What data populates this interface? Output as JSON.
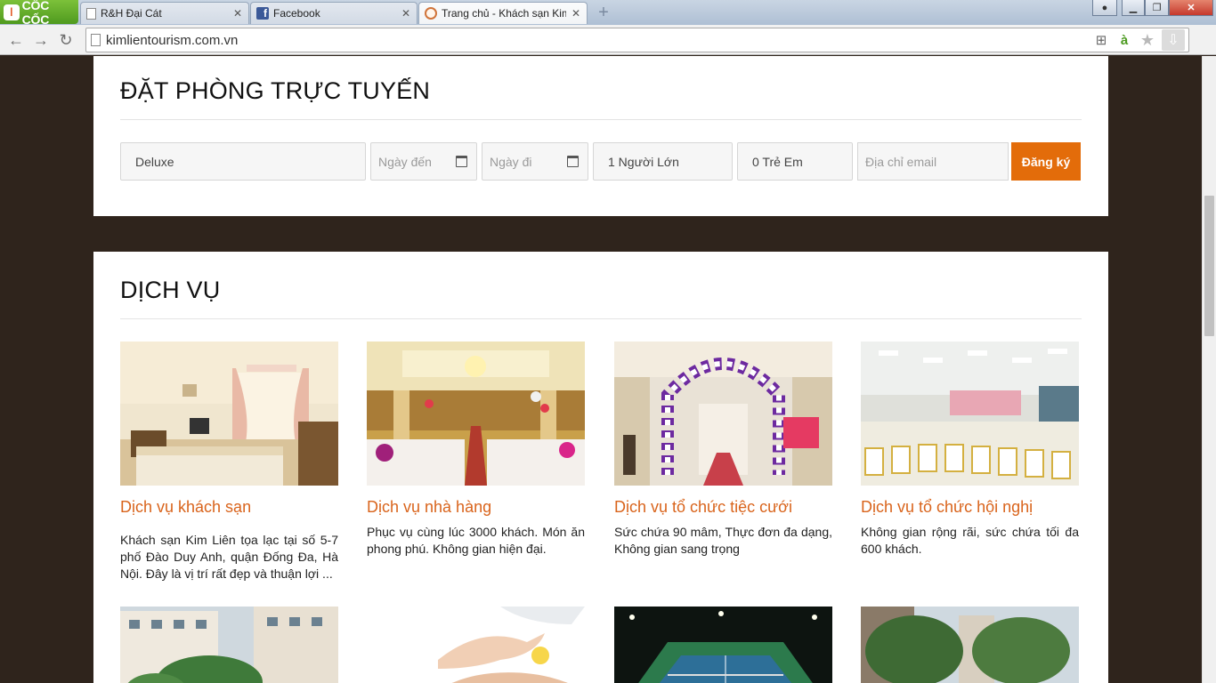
{
  "browser": {
    "brand": "CỐC CỐC",
    "tabs": [
      {
        "title": "R&H Đại Cát",
        "icon": "page-icon"
      },
      {
        "title": "Facebook",
        "icon": "facebook-icon"
      },
      {
        "title": "Trang chủ - Khách sạn Kim Liên",
        "icon": "hotel-icon",
        "active": true
      }
    ],
    "url": "kimlientourism.com.vn"
  },
  "booking": {
    "title": "ĐẶT PHÒNG TRỰC TUYẾN",
    "room_type": "Deluxe",
    "arrival_placeholder": "Ngày đến",
    "departure_placeholder": "Ngày đi",
    "adults": "1 Người Lớn",
    "children": "0 Trẻ Em",
    "email_placeholder": "Địa chỉ email",
    "submit_label": "Đăng ký"
  },
  "services": {
    "title": "DỊCH VỤ",
    "items": [
      {
        "title": "Dịch vụ khách sạn",
        "desc": "Khách sạn Kim Liên tọa lạc tại số 5-7 phố Đào Duy Anh, quận Đống Đa, Hà Nội. Đây là vị trí rất đẹp và thuận lợi ..."
      },
      {
        "title": "Dịch vụ nhà hàng",
        "desc": "Phục vụ cùng lúc 3000 khách. Món ăn phong phú. Không gian hiện đại."
      },
      {
        "title": "Dịch vụ tổ chức tiệc cưới",
        "desc": "Sức chứa 90 mâm, Thực đơn đa dạng, Không gian sang trọng"
      },
      {
        "title": "Dịch vụ tổ chức hội nghị",
        "desc": "Không gian rộng rãi, sức chứa tối đa 600 khách."
      }
    ]
  },
  "colors": {
    "accent": "#e36c0a",
    "link": "#d9641c",
    "page_bg": "#2f241c"
  }
}
